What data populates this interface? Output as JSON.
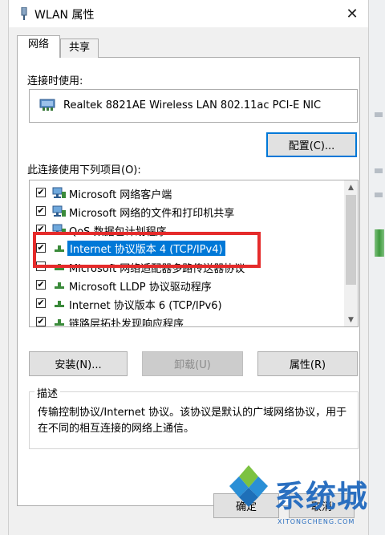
{
  "window": {
    "title": "WLAN 属性"
  },
  "tabs": [
    {
      "label": "网络"
    },
    {
      "label": "共享"
    }
  ],
  "connect_using_label": "连接时使用:",
  "adapter": {
    "name": "Realtek 8821AE Wireless LAN 802.11ac PCI-E NIC"
  },
  "configure_label": "配置(C)...",
  "items_label": "此连接使用下列项目(O):",
  "items": [
    {
      "label": "Microsoft 网络客户端",
      "checked": true
    },
    {
      "label": "Microsoft 网络的文件和打印机共享",
      "checked": true
    },
    {
      "label": "QoS 数据包计划程序",
      "checked": true
    },
    {
      "label": "Internet 协议版本 4 (TCP/IPv4)",
      "checked": true,
      "selected": true
    },
    {
      "label": "Microsoft 网络适配器多路传送器协议",
      "checked": false
    },
    {
      "label": "Microsoft LLDP 协议驱动程序",
      "checked": true
    },
    {
      "label": "Internet 协议版本 6 (TCP/IPv6)",
      "checked": true
    },
    {
      "label": "链路层拓扑发现响应程序",
      "checked": true
    }
  ],
  "buttons": {
    "install": "安装(N)...",
    "uninstall": "卸载(U)",
    "properties": "属性(R)",
    "ok": "确定",
    "cancel": "取消"
  },
  "description": {
    "title": "描述",
    "text": "传输控制协议/Internet 协议。该协议是默认的广域网络协议，用于在不同的相互连接的网络上通信。"
  },
  "watermark": {
    "text": "系统城",
    "sub": "XITONGCHENG.COM"
  },
  "colors": {
    "selection": "#0078d7",
    "highlight_border": "#e52b2b",
    "watermark": "#2a6fc0"
  }
}
